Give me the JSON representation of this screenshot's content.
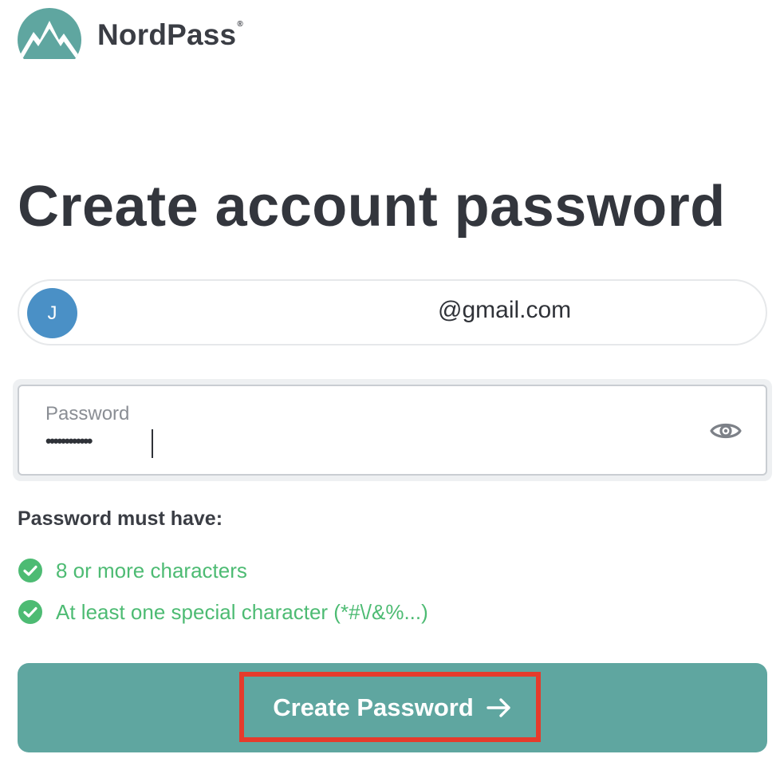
{
  "brand": {
    "name": "NordPass",
    "registered_mark": "®",
    "logo_icon": "nordpass-mountain-logo-icon",
    "accent_color": "#5fa6a0"
  },
  "page": {
    "title": "Create account password"
  },
  "account": {
    "avatar_initial": "J",
    "avatar_color": "#4a90c6",
    "email": "@gmail.com"
  },
  "password_field": {
    "label": "Password",
    "masked_value": "••••••••••••",
    "toggle_icon": "eye-icon"
  },
  "requirements": {
    "heading": "Password must have:",
    "items": [
      {
        "label": "8 or more characters",
        "status": "met",
        "icon": "check-circle-icon"
      },
      {
        "label": "At least one special character (*#\\/&%...)",
        "status": "met",
        "icon": "check-circle-icon"
      }
    ],
    "met_color": "#4dbb73"
  },
  "submit": {
    "label": "Create Password",
    "icon": "arrow-right-icon",
    "highlight_color": "#e53b2c"
  }
}
